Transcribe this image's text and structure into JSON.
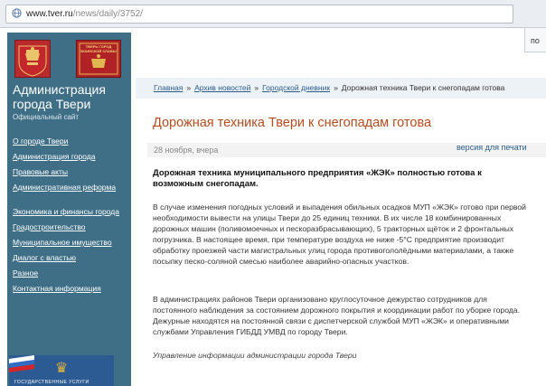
{
  "browser": {
    "url_host": "www.tver.ru",
    "url_path": "/news/daily/3752/"
  },
  "sidebar": {
    "flag_text": "ТВЕРЬ ГОРОД ВОИНСКОЙ СЛАВЫ",
    "title": "Администрация города Твери",
    "subtitle": "Официальный сайт",
    "nav_group1": [
      {
        "label": "О городе Твери"
      },
      {
        "label": "Администрация города"
      },
      {
        "label": "Правовые акты"
      },
      {
        "label": "Административная реформа"
      }
    ],
    "nav_group2": [
      {
        "label": "Экономика и финансы города"
      },
      {
        "label": "Градостроительство"
      },
      {
        "label": "Муниципальное имущество"
      },
      {
        "label": "Диалог с властью"
      },
      {
        "label": "Разное"
      },
      {
        "label": "Контактная информация"
      }
    ],
    "banner_text": "ГОСУДАРСТВЕННЫЕ УСЛУГИ"
  },
  "search_stub_text": "по",
  "breadcrumbs": {
    "home": "Главная",
    "archive": "Архив новостей",
    "diary": "Городской дневник",
    "current": "Дорожная техника Твери к снегопадам готова",
    "separator": "»"
  },
  "article": {
    "title": "Дорожная техника Твери к снегопадам готова",
    "date": "28 ноября, вчера",
    "print_label": "версия для печати",
    "lead": "Дорожная техника муниципального предприятия «ЖЭК» полностью готова к возможным снегопадам.",
    "paragraph1": "В случае изменения погодных условий и выпадения обильных осадков МУП «ЖЭК» готово при первой необходимости вывести на улицы Твери до 25 единиц техники. В их числе 18 комбинированных дорожных машин (поливомоечных и пескоразбрасывающих), 5 тракторных щёток и 2 фронтальных погрузчика. В настоящее время, при температуре воздуха не ниже -5°С предприятие производит обработку проезжей части магистральных улиц города противогололёдными материалами, а также посыпку песко-соляной смесью наиболее аварийно-опасных участков.",
    "paragraph2": "В администрациях районов Твери организовано круглосуточное дежурство сотрудников для постоянного наблюдения за состоянием дорожного покрытия и координации работ по уборке города. Дежурные находятся на постоянной связи с диспетчерской службой МУП «ЖЭК» и оперативными службами Управления ГИБДД УМВД по городу Твери.",
    "source": "Управление информации администрации города Твери"
  },
  "colors": {
    "sidebar_bg": "#3f6f86",
    "title_accent": "#bb4a1c",
    "link": "#2a5b8a"
  }
}
